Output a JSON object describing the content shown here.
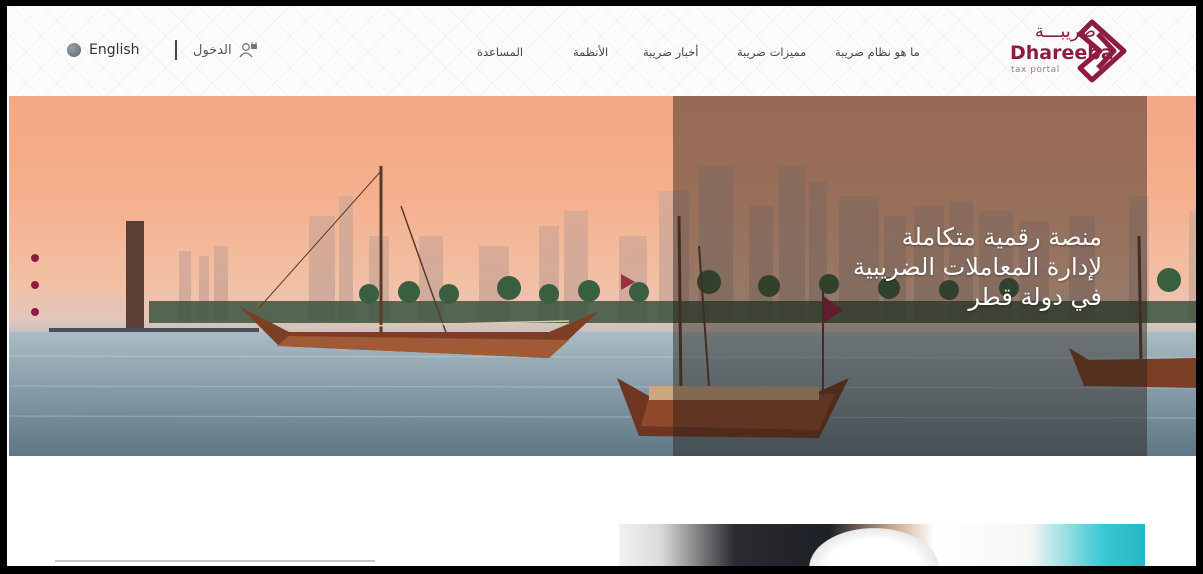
{
  "header": {
    "language_label": "English",
    "login_label": "الدخول",
    "nav_items": [
      {
        "label": "ما هو نظام ضريبة"
      },
      {
        "label": "مميزات ضريبة"
      },
      {
        "label": "أخبار ضريبة"
      },
      {
        "label": "الأنظمة"
      },
      {
        "label": "المساعدة"
      }
    ],
    "logo": {
      "arabic": "ضريبـــة",
      "english": "Dhareeba",
      "tagline": "tax portal"
    }
  },
  "hero": {
    "headline_lines": [
      "منصة رقمية متكاملة",
      "لإدارة المعاملات الضريبية",
      "في دولة قطر"
    ],
    "slide_count": 3,
    "active_slide": 1
  },
  "colors": {
    "brand": "#8c1d40",
    "sky_top": "#f3a786",
    "water": "#7f97a5"
  }
}
